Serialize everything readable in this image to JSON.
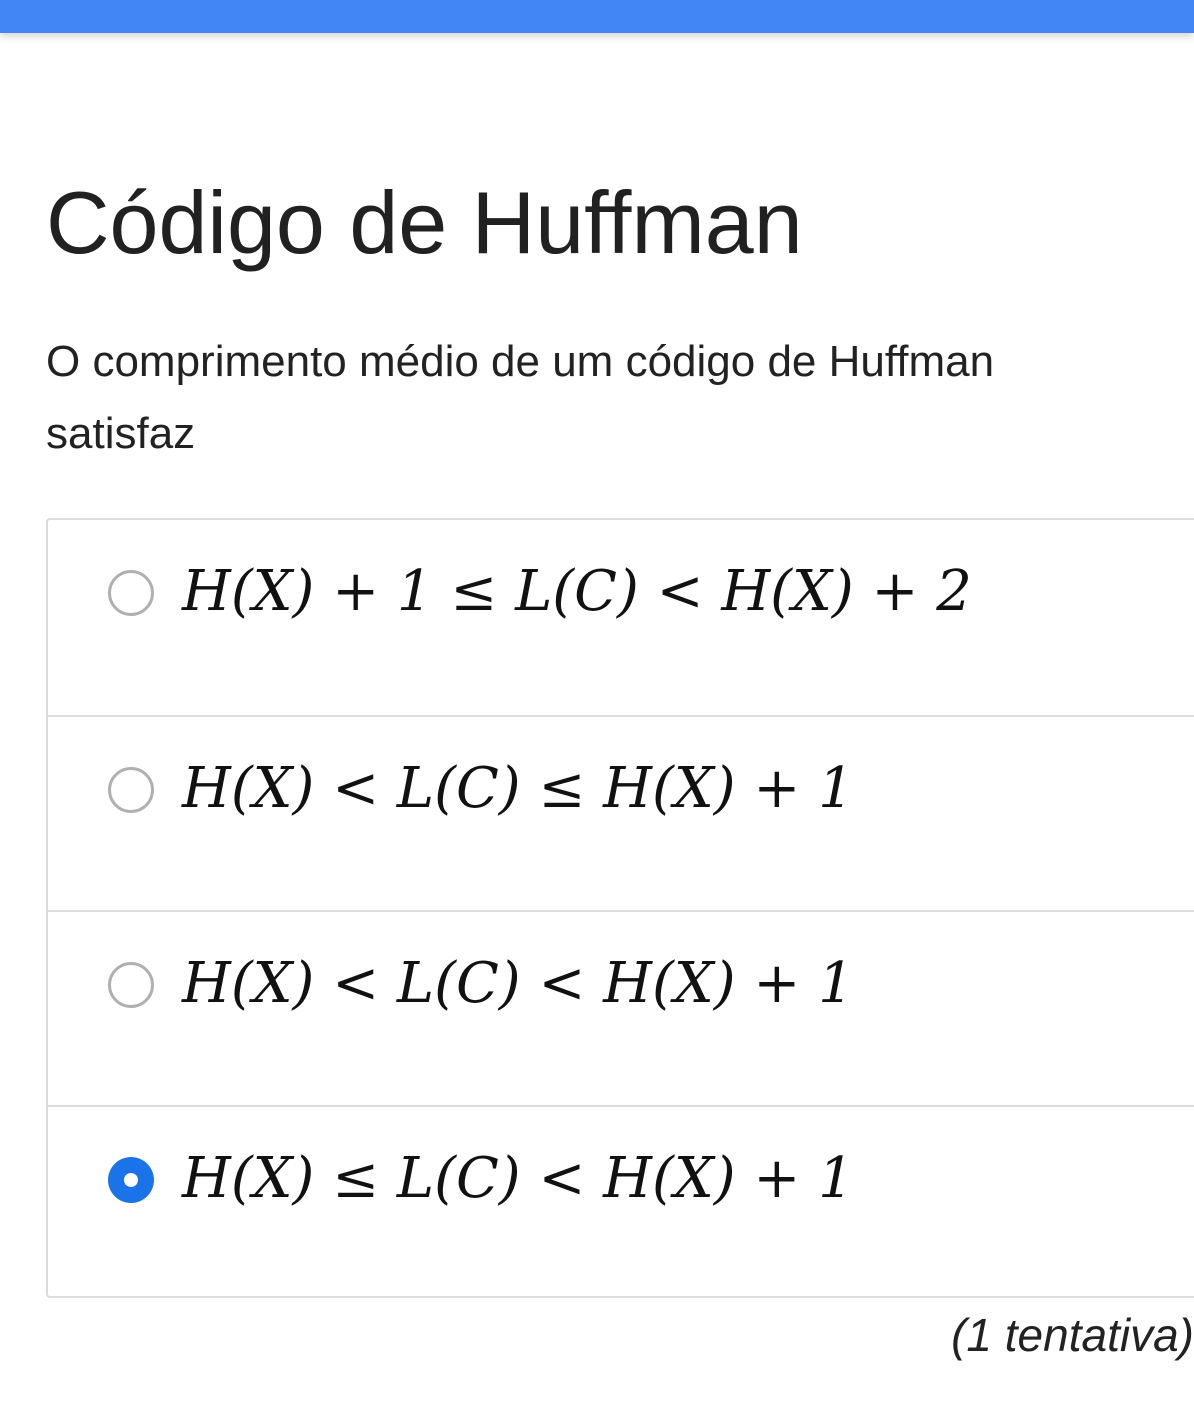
{
  "header": {
    "accent_color": "#4285f4"
  },
  "page": {
    "title": "Código de Huffman",
    "question": "O comprimento médio de um código de Huffman satisfaz"
  },
  "options": [
    {
      "formula": "H(X) + 1 ≤ L(C) < H(X) + 2",
      "selected": false
    },
    {
      "formula": "H(X) < L(C) ≤ H(X) + 1",
      "selected": false
    },
    {
      "formula": "H(X) < L(C) < H(X) + 1",
      "selected": false
    },
    {
      "formula": "H(X) ≤ L(C) < H(X) + 1",
      "selected": true
    }
  ],
  "attempts": "(1 tentativa)",
  "colors": {
    "radio_selected": "#1a73e8",
    "border": "#dcdcdc"
  }
}
